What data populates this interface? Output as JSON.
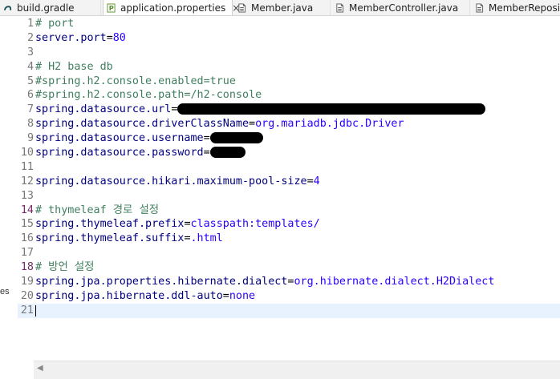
{
  "tabs": [
    {
      "label": "build.gradle",
      "icon": "gradle-icon",
      "active": false
    },
    {
      "label": "application.properties",
      "icon": "properties-file-icon",
      "active": true,
      "close": "×"
    },
    {
      "label": "Member.java",
      "icon": "java-file-icon",
      "active": false
    },
    {
      "label": "MemberController.java",
      "icon": "java-file-icon",
      "active": false
    },
    {
      "label": "MemberRepositor",
      "icon": "java-file-icon",
      "active": false
    }
  ],
  "left_fragment": "es",
  "editor": {
    "current_line": 21,
    "lines": [
      {
        "n": "1",
        "comment": "# port"
      },
      {
        "n": "2",
        "key": "server.port",
        "value": "80"
      },
      {
        "n": "3"
      },
      {
        "n": "4",
        "comment": "# H2 base db"
      },
      {
        "n": "5",
        "comment": "#spring.h2.console.enabled=true"
      },
      {
        "n": "6",
        "comment": "#spring.h2.console.path=/h2-console"
      },
      {
        "n": "7",
        "key": "spring.datasource.url",
        "redacted": true
      },
      {
        "n": "8",
        "key": "spring.datasource.driverClassName",
        "value": "org.mariadb.jdbc.Driver"
      },
      {
        "n": "9",
        "key": "spring.datasource.username",
        "redacted": true
      },
      {
        "n": "10",
        "key": "spring.datasource.password",
        "redacted": true
      },
      {
        "n": "11"
      },
      {
        "n": "12",
        "key": "spring.datasource.hikari.maximum-pool-size",
        "value": "4"
      },
      {
        "n": "13"
      },
      {
        "n": "14",
        "comment": "# thymeleaf 경로 설정",
        "changed": true
      },
      {
        "n": "15",
        "key": "spring.thymeleaf.prefix",
        "value": "classpath:templates/"
      },
      {
        "n": "16",
        "key": "spring.thymeleaf.suffix",
        "value": ".html"
      },
      {
        "n": "17"
      },
      {
        "n": "18",
        "comment": "# 방언 설정",
        "changed": true
      },
      {
        "n": "19",
        "key": "spring.jpa.properties.hibernate.dialect",
        "value": "org.hibernate.dialect.H2Dialect"
      },
      {
        "n": "20",
        "key": "spring.jpa.hibernate.ddl-auto",
        "value": "none"
      },
      {
        "n": "21"
      }
    ]
  },
  "colors": {
    "comment": "#3f7f5f",
    "key": "#000080",
    "value": "#2a00ff",
    "current_line": "#e8f2fe"
  }
}
